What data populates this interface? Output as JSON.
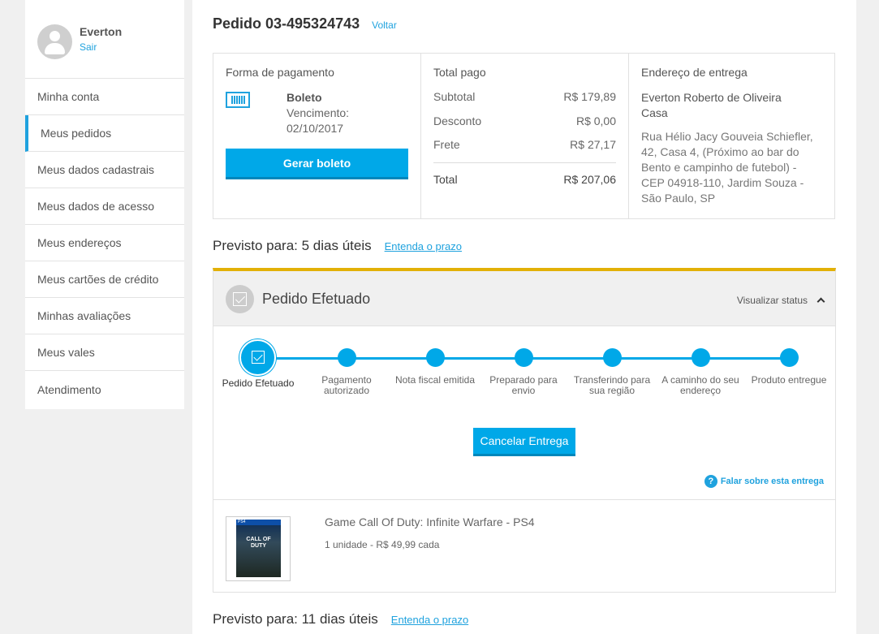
{
  "user": {
    "name": "Everton",
    "logout": "Sair"
  },
  "sidebar": {
    "items": [
      {
        "label": "Minha conta"
      },
      {
        "label": "Meus pedidos"
      },
      {
        "label": "Meus dados cadastrais"
      },
      {
        "label": "Meus dados de acesso"
      },
      {
        "label": "Meus endereços"
      },
      {
        "label": "Meus cartões de crédito"
      },
      {
        "label": "Minhas avaliações"
      },
      {
        "label": "Meus vales"
      },
      {
        "label": "Atendimento"
      }
    ]
  },
  "order": {
    "title": "Pedido 03-495324743",
    "back": "Voltar"
  },
  "payment": {
    "title": "Forma de pagamento",
    "method": "Boleto",
    "due_label": "Vencimento:",
    "due_date": "02/10/2017",
    "button": "Gerar boleto"
  },
  "totals": {
    "title": "Total pago",
    "rows": [
      {
        "label": "Subtotal",
        "value": "R$ 179,89"
      },
      {
        "label": "Desconto",
        "value": "R$ 0,00"
      },
      {
        "label": "Frete",
        "value": "R$ 27,17"
      }
    ],
    "total_label": "Total",
    "total_value": "R$ 207,06"
  },
  "address": {
    "title": "Endereço de entrega",
    "name": "Everton Roberto de Oliveira",
    "type": "Casa",
    "line1": "Rua Hélio Jacy Gouveia Schiefler,",
    "line2": "42, Casa 4, (Próximo ao bar do",
    "line3": "Bento e campinho de futebol) -",
    "line4": "CEP 04918-110, Jardim Souza -",
    "line5": "São Paulo, SP"
  },
  "forecast1": {
    "text": "Previsto para: 5 dias úteis",
    "link": "Entenda o prazo"
  },
  "forecast2": {
    "text": "Previsto para: 11 dias úteis",
    "link": "Entenda o prazo"
  },
  "status": {
    "title": "Pedido Efetuado",
    "toggle": "Visualizar status",
    "progress_steps_completed": 1,
    "steps": [
      {
        "label": "Pedido Efetuado"
      },
      {
        "label": "Pagamento autorizado"
      },
      {
        "label": "Nota fiscal emitida"
      },
      {
        "label": "Preparado para envio"
      },
      {
        "label": "Transferindo para sua região"
      },
      {
        "label": "A caminho do seu endereço"
      },
      {
        "label": "Produto entregue"
      }
    ],
    "cancel_button": "Cancelar Entrega",
    "help_icon": "?",
    "help_link": "Falar sobre esta entrega"
  },
  "item": {
    "name": "Game Call Of Duty: Infinite Warfare - PS4",
    "qty": "1 unidade - R$ 49,99 cada",
    "cover_platform": "PS4",
    "cover_title": "CALL OF DUTY"
  },
  "colors": {
    "accent": "#00a8e8",
    "link": "#1fa2de",
    "status_bar": "#e2b007"
  },
  "icons": {
    "avatar": "user-avatar-icon",
    "payment": "barcode-icon",
    "status": "check-icon",
    "toggle": "chevron-up-icon",
    "help": "question-icon"
  }
}
